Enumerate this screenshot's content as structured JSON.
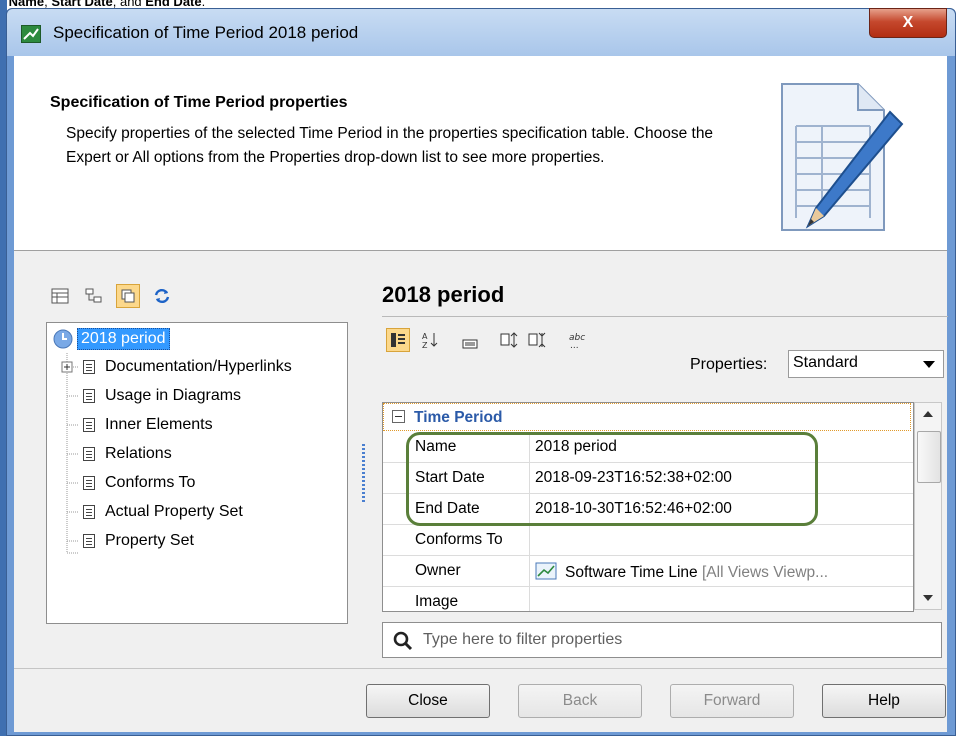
{
  "caption": {
    "part1": "r Name",
    "sep1": ", ",
    "part2": "Start Date",
    "sep2": ", and ",
    "part3": "End Date",
    "end": "."
  },
  "window": {
    "title": "Specification of Time Period 2018 period",
    "close_label": "X"
  },
  "header": {
    "title": "Specification of Time Period properties",
    "description": "Specify properties of the selected Time Period in the properties specification table. Choose the Expert or All options from the Properties drop-down list to see more properties."
  },
  "tree": {
    "root": "2018 period",
    "items": [
      "Documentation/Hyperlinks",
      "Usage in Diagrams",
      "Inner Elements",
      "Relations",
      "Conforms To",
      "Actual Property Set",
      "Property Set"
    ]
  },
  "panel": {
    "title": "2018 period",
    "properties_label": "Properties:",
    "properties_value": "Standard",
    "section_title": "Time Period",
    "rows": [
      {
        "key": "Name",
        "value": "2018 period"
      },
      {
        "key": "Start Date",
        "value": "2018-09-23T16:52:38+02:00"
      },
      {
        "key": "End Date",
        "value": "2018-10-30T16:52:46+02:00"
      },
      {
        "key": "Conforms To",
        "value": ""
      },
      {
        "key": "Owner",
        "value": "Software Time Line",
        "value_extra": "[All Views Viewp..."
      },
      {
        "key": "Image",
        "value": ""
      }
    ],
    "filter_placeholder": "Type here to filter properties"
  },
  "buttons": {
    "close": "Close",
    "back": "Back",
    "forward": "Forward",
    "help": "Help"
  },
  "colors": {
    "highlight_box": "#5a7f3a",
    "section_title": "#2b5aa8",
    "selection": "#3399ff"
  }
}
